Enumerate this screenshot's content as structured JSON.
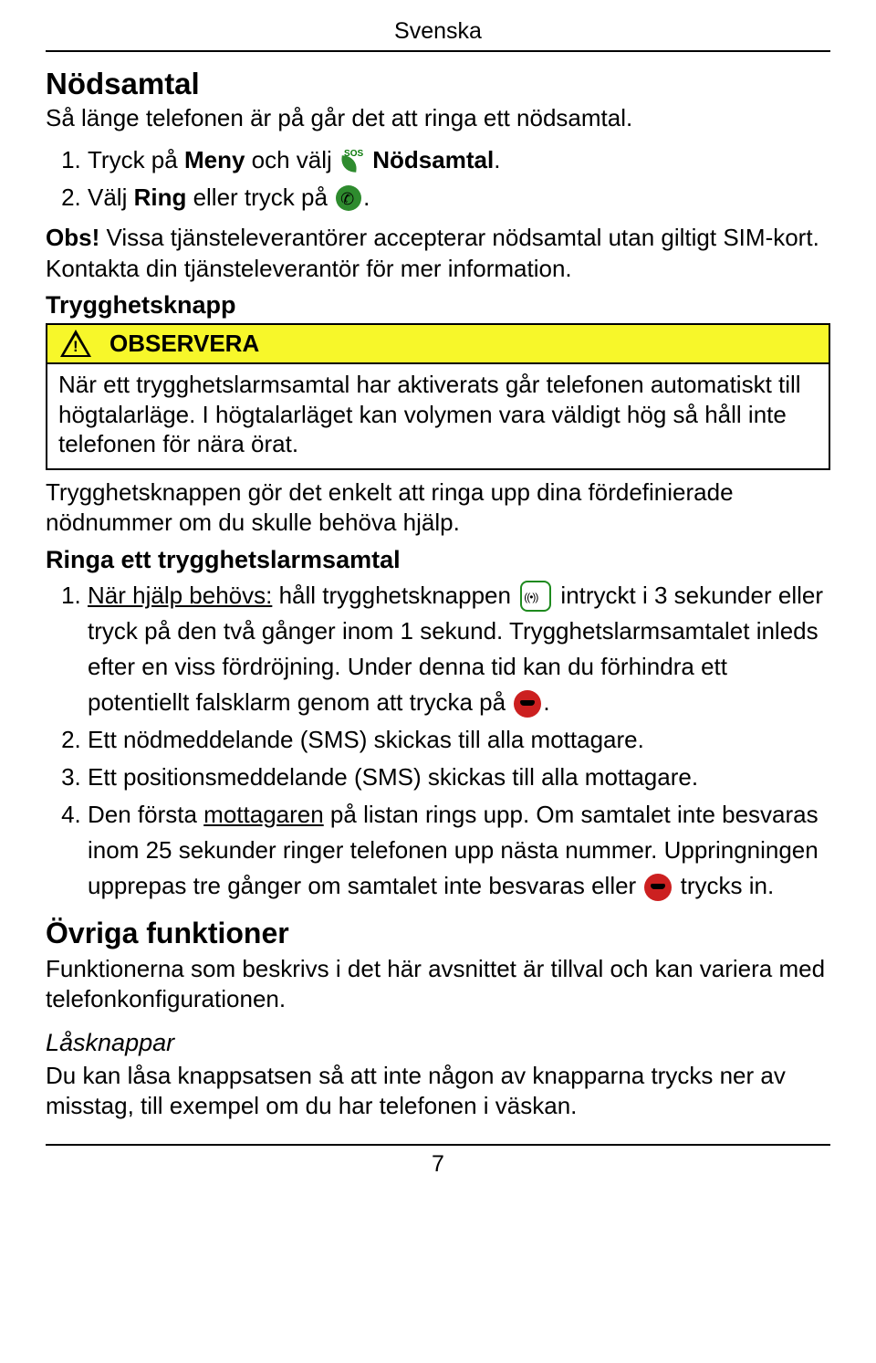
{
  "header": {
    "language": "Svenska"
  },
  "sec_emergency": {
    "title": "Nödsamtal",
    "intro": "Så länge telefonen är på går det att ringa ett nödsamtal.",
    "steps": {
      "s1_a": "Tryck på ",
      "s1_menu": "Meny",
      "s1_b": " och välj ",
      "s1_c": " Nödsamtal",
      "s1_d": ".",
      "s2_a": "Välj ",
      "s2_ring": "Ring",
      "s2_b": " eller tryck på ",
      "s2_c": "."
    },
    "obs_label": "Obs!",
    "obs_text": " Vissa tjänsteleverantörer accepterar nödsamtal utan giltigt SIM-kort. Kontakta din tjänsteleverantör för mer information."
  },
  "sec_safety": {
    "title": "Trygghetsknapp",
    "observera_label": "OBSERVERA",
    "observera_body": "När ett trygghetslarmsamtal har aktiverats går telefonen automatiskt till högtalarläge. I högtalarläget kan volymen vara väldigt hög så håll inte telefonen för nära örat.",
    "para1": "Trygghetsknappen gör det enkelt att ringa upp dina fördefinierade nödnummer om du skulle behöva hjälp.",
    "call_title": "Ringa ett trygghetslarmsamtal",
    "steps": {
      "s1_u": "När hjälp behövs:",
      "s1_a": " håll trygghetsknappen ",
      "s1_b": " intryckt i 3 sekunder eller tryck på den två gånger inom 1 sekund. Trygghetslarmsamtalet inleds efter en viss fördröjning. Under denna tid kan du förhindra ett potentiellt falsklarm genom att trycka på ",
      "s1_c": ".",
      "s2": "Ett nödmeddelande (SMS) skickas till alla mottagare.",
      "s3": "Ett positionsmeddelande (SMS) skickas till alla mottagare.",
      "s4_a": "Den första ",
      "s4_u": "mottagaren",
      "s4_b": " på listan rings upp. Om samtalet inte besvaras inom 25 sekunder ringer telefonen upp nästa nummer. Uppringningen upprepas tre gånger om samtalet inte besvaras eller ",
      "s4_c": " trycks in."
    }
  },
  "sec_other": {
    "title": "Övriga funktioner",
    "para": "Funktionerna som beskrivs i det här avsnittet är tillval och kan variera med telefonkonfigurationen."
  },
  "sec_lock": {
    "title": "Låsknappar",
    "para": "Du kan låsa knappsatsen så att inte någon av knapparna trycks ner av misstag, till exempel om du har telefonen i väskan."
  },
  "footer": {
    "page": "7"
  }
}
